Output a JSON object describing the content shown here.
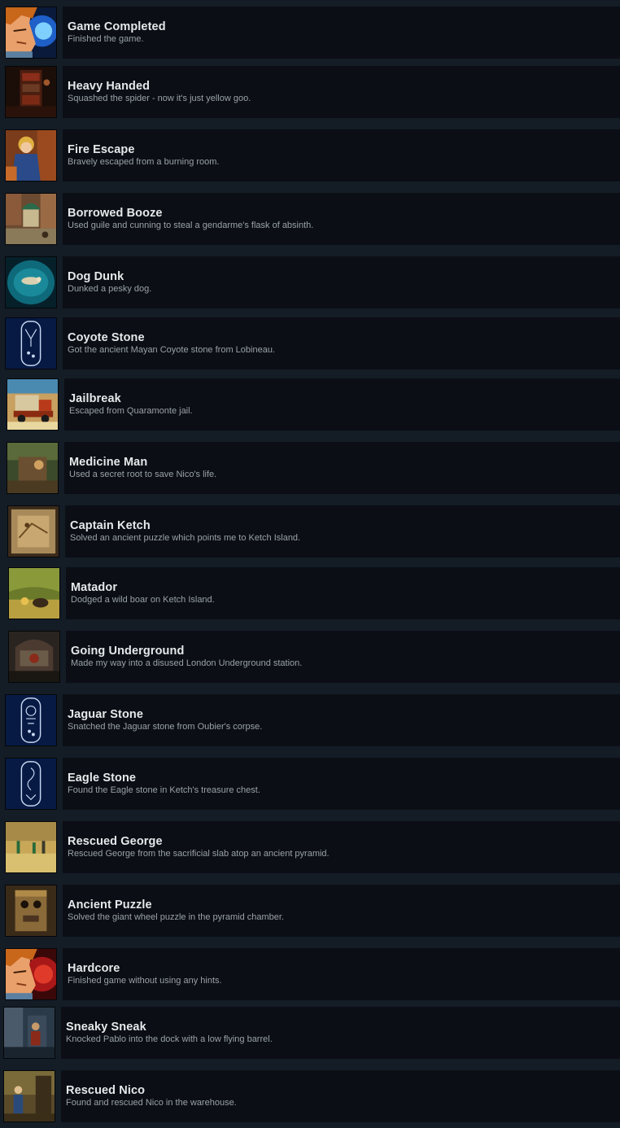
{
  "achievements": [
    {
      "title": "Game Completed",
      "description": "Finished the game.",
      "icon": "george-portrait-blue-icon"
    },
    {
      "title": "Heavy Handed",
      "description": "Squashed the spider - now it's just yellow goo.",
      "icon": "dark-library-icon"
    },
    {
      "title": "Fire Escape",
      "description": "Bravely escaped from a burning room.",
      "icon": "george-escape-icon"
    },
    {
      "title": "Borrowed Booze",
      "description": "Used guile and cunning to steal a gendarme's flask of absinth.",
      "icon": "paris-cafe-icon"
    },
    {
      "title": "Dog Dunk",
      "description": "Dunked a pesky dog.",
      "icon": "dog-in-water-icon"
    },
    {
      "title": "Coyote Stone",
      "description": "Got the ancient Mayan Coyote stone from Lobineau.",
      "icon": "coyote-stone-icon"
    },
    {
      "title": "Jailbreak",
      "description": "Escaped from Quaramonte jail.",
      "icon": "truck-icon"
    },
    {
      "title": "Medicine Man",
      "description": "Used a secret root to save Nico's life.",
      "icon": "jungle-hut-icon"
    },
    {
      "title": "Captain Ketch",
      "description": "Solved an ancient puzzle which points me to Ketch Island.",
      "icon": "map-puzzle-icon"
    },
    {
      "title": "Matador",
      "description": "Dodged a wild boar on Ketch Island.",
      "icon": "jungle-boar-icon"
    },
    {
      "title": "Going Underground",
      "description": "Made my way into a disused London Underground station.",
      "icon": "underground-station-icon"
    },
    {
      "title": "Jaguar Stone",
      "description": "Snatched the Jaguar stone from Oubier's corpse.",
      "icon": "jaguar-stone-icon"
    },
    {
      "title": "Eagle Stone",
      "description": "Found the Eagle stone in Ketch's treasure chest.",
      "icon": "eagle-stone-icon"
    },
    {
      "title": "Rescued George",
      "description": "Rescued George from the sacrificial slab atop an ancient pyramid.",
      "icon": "pyramid-top-icon"
    },
    {
      "title": "Ancient Puzzle",
      "description": "Solved the giant wheel puzzle in the pyramid chamber.",
      "icon": "stone-wheel-icon"
    },
    {
      "title": "Hardcore",
      "description": "Finished game without using any hints.",
      "icon": "george-portrait-red-icon"
    },
    {
      "title": "Sneaky Sneak",
      "description": "Knocked Pablo into the dock with a low flying barrel.",
      "icon": "dock-icon"
    },
    {
      "title": "Rescued Nico",
      "description": "Found and rescued Nico in the warehouse.",
      "icon": "warehouse-icon"
    }
  ]
}
